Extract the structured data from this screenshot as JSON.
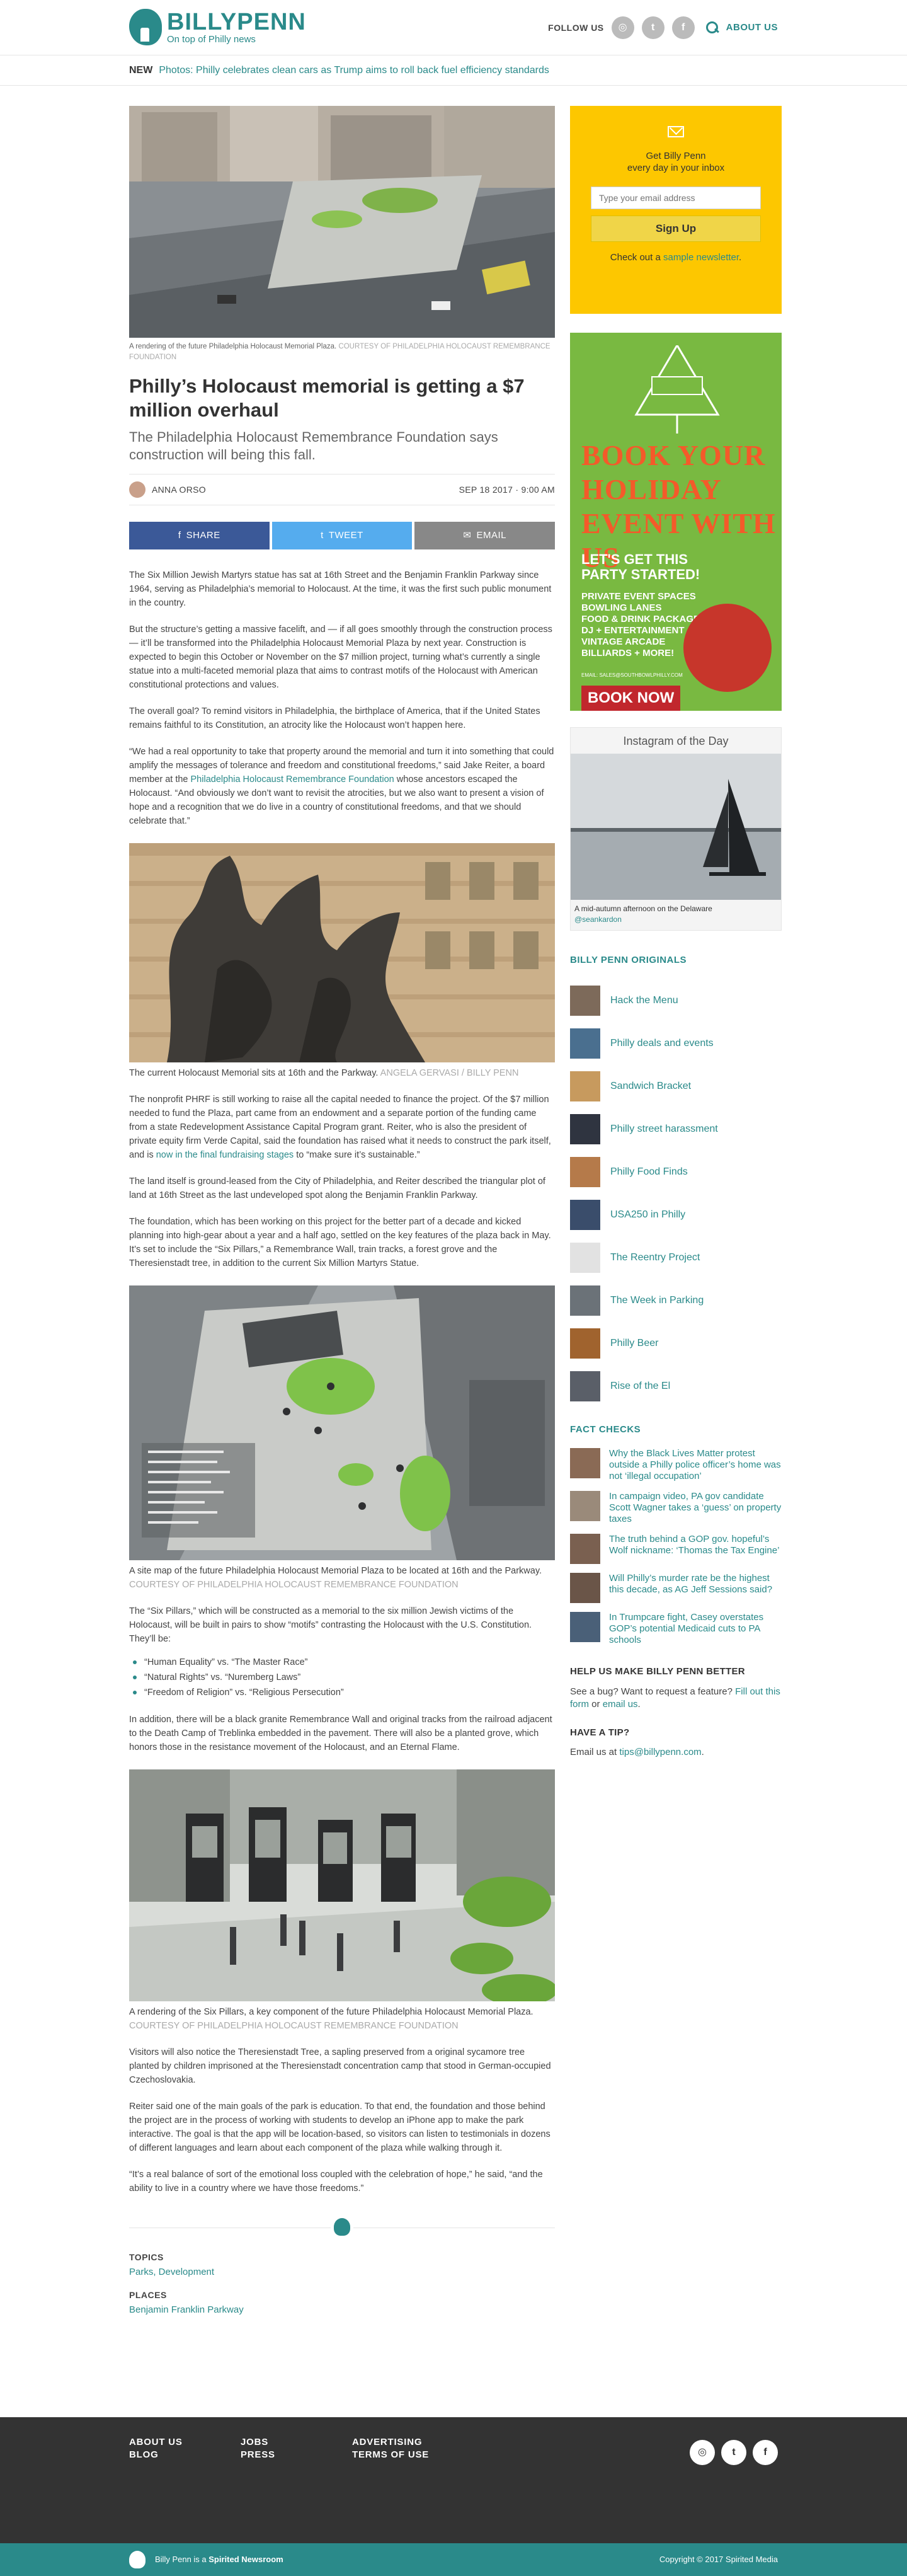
{
  "header": {
    "logo_name": "BILLYPENN",
    "logo_tagline": "On top of Philly news",
    "follow_label": "FOLLOW US",
    "social": [
      "instagram-icon",
      "twitter-icon",
      "facebook-icon"
    ],
    "about_label": "ABOUT US"
  },
  "news_bar": {
    "label": "NEW",
    "headline": "Photos: Philly celebrates clean cars as Trump aims to roll back fuel efficiency standards"
  },
  "article": {
    "hero_caption": "A rendering of the future Philadelphia Holocaust Memorial Plaza.",
    "hero_credit": "COURTESY OF PHILADELPHIA HOLOCAUST REMEMBRANCE FOUNDATION",
    "title": "Philly’s Holocaust memorial is getting a $7 million overhaul",
    "dek": "The Philadelphia Holocaust Remembrance Foundation says construction will being this fall.",
    "author": "ANNA ORSO",
    "date": "SEP 18 2017",
    "time": "9:00 AM",
    "share": {
      "facebook": "SHARE",
      "twitter": "TWEET",
      "email": "EMAIL"
    },
    "p1": "The Six Million Jewish Martyrs statue has sat at 16th Street and the Benjamin Franklin Parkway since 1964, serving as Philadelphia’s memorial to Holocaust. At the time, it was the first such public monument in the country.",
    "p2": "But the structure’s getting a massive facelift, and — if all goes smoothly through the construction process — it’ll be transformed into the Philadelphia Holocaust Memorial Plaza by next year. Construction is expected to begin this October or November on the $7 million project, turning what’s currently a single statue into a multi-faceted memorial plaza that aims to contrast motifs of the Holocaust with American constitutional protections and values.",
    "p3": "The overall goal? To remind visitors in Philadelphia, the birthplace of America, that if the United States remains faithful to its Constitution, an atrocity like the Holocaust won’t happen here.",
    "p4a": "“We had a real opportunity to take that property around the memorial and turn it into something that could amplify the messages of tolerance and freedom and constitutional freedoms,” said Jake Reiter, a board member at the ",
    "p4link": "Philadelphia Holocaust Remembrance Foundation",
    "p4b": " whose ancestors escaped the Holocaust. “And obviously we don’t want to revisit the atrocities, but we also want to present a vision of hope and a recognition that we do live in a country of constitutional freedoms, and that we should celebrate that.”",
    "img2_caption": "The current Holocaust Memorial sits at 16th and the Parkway.",
    "img2_credit": "ANGELA GERVASI / BILLY PENN",
    "p5a": "The nonprofit PHRF is still working to raise all the capital needed to finance the project. Of the $7 million needed to fund the Plaza, part came from an endowment and a separate portion of the funding came from a state Redevelopment Assistance Capital Program grant. Reiter, who is also the president of private equity firm Verde Capital, said the foundation has raised what it needs to construct the park itself, and is ",
    "p5link": "now in the final fundraising stages",
    "p5b": " to “make sure it’s sustainable.”",
    "p6": "The land itself is ground-leased from the City of Philadelphia, and Reiter described the triangular plot of land at 16th Street as the last undeveloped spot along the Benjamin Franklin Parkway.",
    "p7": "The foundation, which has been working on this project for the better part of a decade and kicked planning into high-gear about a year and a half ago, settled on the key features of the plaza back in May. It’s set to include the “Six Pillars,” a Remembrance Wall, train tracks, a forest grove and the Theresienstadt tree, in addition to the current Six Million Martyrs Statue.",
    "img3_caption": "A site map of the future Philadelphia Holocaust Memorial Plaza to be located at 16th and the Parkway.",
    "img3_credit": "COURTESY OF PHILADELPHIA HOLOCAUST REMEMBRANCE FOUNDATION",
    "p8": "The “Six Pillars,” which will be constructed as a memorial to the six million Jewish victims of the Holocaust, will be built in pairs to show “motifs” contrasting the Holocaust with the U.S. Constitution. They’ll be:",
    "bullets": [
      "“Human Equality” vs. “The Master Race”",
      "“Natural Rights” vs. “Nuremberg Laws”",
      "“Freedom of Religion” vs. “Religious Persecution”"
    ],
    "p9": "In addition, there will be a black granite Remembrance Wall and original tracks from the railroad adjacent to the Death Camp of Treblinka embedded in the pavement. There will also be a planted grove, which honors those in the resistance movement of the Holocaust, and an Eternal Flame.",
    "img4_caption": "A rendering of the Six Pillars, a key component of the future Philadelphia Holocaust Memorial Plaza.",
    "img4_credit": "COURTESY OF PHILADELPHIA HOLOCAUST REMEMBRANCE FOUNDATION",
    "p10": "Visitors will also notice the Theresienstadt Tree, a sapling preserved from a original sycamore tree planted by children imprisoned at the Theresienstadt concentration camp that stood in German-occupied Czechoslovakia.",
    "p11": "Reiter said one of the main goals of the park is education. To that end, the foundation and those behind the project are in the process of working with students to develop an iPhone app to make the park interactive. The goal is that the app will be location-based, so visitors can listen to testimonials in dozens of different languages and learn about each component of the plaza while walking through it.",
    "p12": "“It’s a real balance of sort of the emotional loss coupled with the celebration of hope,” he said, “and the ability to live in a country where we have those freedoms.”",
    "topics_label": "TOPICS",
    "topics": "Parks, Development",
    "places_label": "PLACES",
    "places": "Benjamin Franklin Parkway"
  },
  "sidebar": {
    "newsletter": {
      "line1": "Get Billy Penn",
      "line2": "every day in your inbox",
      "placeholder": "Type your email address",
      "button": "Sign Up",
      "foot_prefix": "Check out a ",
      "foot_link": "sample newsletter",
      "foot_suffix": "."
    },
    "ad": {
      "headline": "BOOK YOUR HOLIDAY EVENT WITH US",
      "sub1": "LET'S GET THIS",
      "sub2": "PARTY STARTED!",
      "list": [
        "PRIVATE EVENT SPACES",
        "BOWLING LANES",
        "FOOD & DRINK PACKAGES",
        "DJ + ENTERTAINMENT",
        "VINTAGE ARCADE",
        "BILLIARDS + MORE!"
      ],
      "small": "EMAIL: SALES@SOUTHBOWLPHILLY.COM",
      "cta": "BOOK NOW"
    },
    "instagram": {
      "title": "Instagram of the Day",
      "caption": "A mid-autumn afternoon on the Delaware",
      "user": "@seankardon"
    },
    "originals_title": "BILLY PENN ORIGINALS",
    "originals": [
      "Hack the Menu",
      "Philly deals and events",
      "Sandwich Bracket",
      "Philly street harassment",
      "Philly Food Finds",
      "USA250 in Philly",
      "The Reentry Project",
      "The Week in Parking",
      "Philly Beer",
      "Rise of the El"
    ],
    "factchecks_title": "FACT CHECKS",
    "factchecks": [
      "Why the Black Lives Matter protest outside a Philly police officer’s home was not ‘illegal occupation’",
      "In campaign video, PA gov candidate Scott Wagner takes a ‘guess’ on property taxes",
      "The truth behind a GOP gov. hopeful’s Wolf nickname: ‘Thomas the Tax Engine’",
      "Will Philly’s murder rate be the highest this decade, as AG Jeff Sessions said?",
      "In Trumpcare fight, Casey overstates GOP’s potential Medicaid cuts to PA schools"
    ],
    "help_title": "HELP US MAKE BILLY PENN BETTER",
    "help_text1": "See a bug? Want to request a feature? ",
    "help_link1": "Fill out this form",
    "help_text2": " or ",
    "help_link2": "email us",
    "help_text3": ".",
    "tip_title": "HAVE A TIP?",
    "tip_text": "Email us at ",
    "tip_link": "tips@billypenn.com",
    "tip_end": "."
  },
  "footer": {
    "links": [
      "ABOUT US",
      "JOBS",
      "ADVERTISING",
      "BLOG",
      "PRESS",
      "TERMS OF USE"
    ],
    "social": [
      "instagram-icon",
      "twitter-icon",
      "facebook-icon"
    ],
    "left_prefix": "Billy Penn is a ",
    "left_brand": "Spirited Newsroom",
    "right": "Copyright © 2017 Spirited Media"
  }
}
